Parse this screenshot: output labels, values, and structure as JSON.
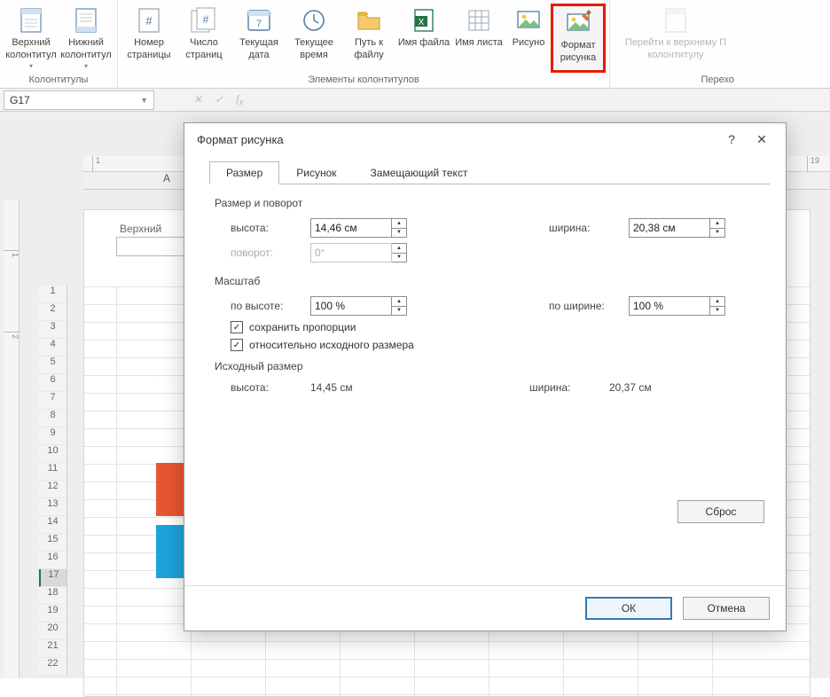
{
  "ribbon": {
    "groups": {
      "hf": {
        "label": "Колонтитулы"
      },
      "elems": {
        "label": "Элементы колонтитулов"
      },
      "nav": {
        "label": "Перехо"
      }
    },
    "buttons": {
      "header": "Верхний колонтитул",
      "footer": "Нижний колонтитул",
      "pagenum": "Номер страницы",
      "pagecount": "Число страниц",
      "curdate": "Текущая дата",
      "curtime": "Текущее время",
      "filepath": "Путь к файлу",
      "filename": "Имя файла",
      "sheetname": "Имя листа",
      "picture": "Рисуно",
      "fmtpic": "Формат рисунка",
      "gotoheader": "Перейти к верхнему П колонтитулу"
    }
  },
  "namebox": "G17",
  "colA": "A",
  "ruler": {
    "h": [
      "1",
      "19"
    ],
    "v": [
      "",
      "1",
      "2"
    ]
  },
  "rows": [
    "1",
    "2",
    "3",
    "4",
    "5",
    "6",
    "7",
    "8",
    "9",
    "10",
    "11",
    "12",
    "13",
    "14",
    "15",
    "16",
    "17",
    "18",
    "19",
    "20",
    "21",
    "22"
  ],
  "selectedRow": "17",
  "pageHeader": "Верхний",
  "dialog": {
    "title": "Формат рисунка",
    "tabs": {
      "size": "Размер",
      "picture": "Рисунок",
      "alttext": "Замещающий текст"
    },
    "sections": {
      "sizerot": "Размер и поворот",
      "scale": "Масштаб",
      "orig": "Исходный размер"
    },
    "labels": {
      "height": "высота:",
      "width": "ширина:",
      "rotation": "поворот:",
      "scaleH": "по высоте:",
      "scaleW": "по ширине:",
      "keepAspect": "сохранить пропорции",
      "relOrig": "относительно исходного размера"
    },
    "values": {
      "height": "14,46 см",
      "width": "20,38 см",
      "rotation": "0°",
      "scaleH": "100 %",
      "scaleW": "100 %",
      "origH": "14,45 см",
      "origW": "20,37 см"
    },
    "buttons": {
      "reset": "Сброс",
      "ok": "ОК",
      "cancel": "Отмена"
    }
  }
}
